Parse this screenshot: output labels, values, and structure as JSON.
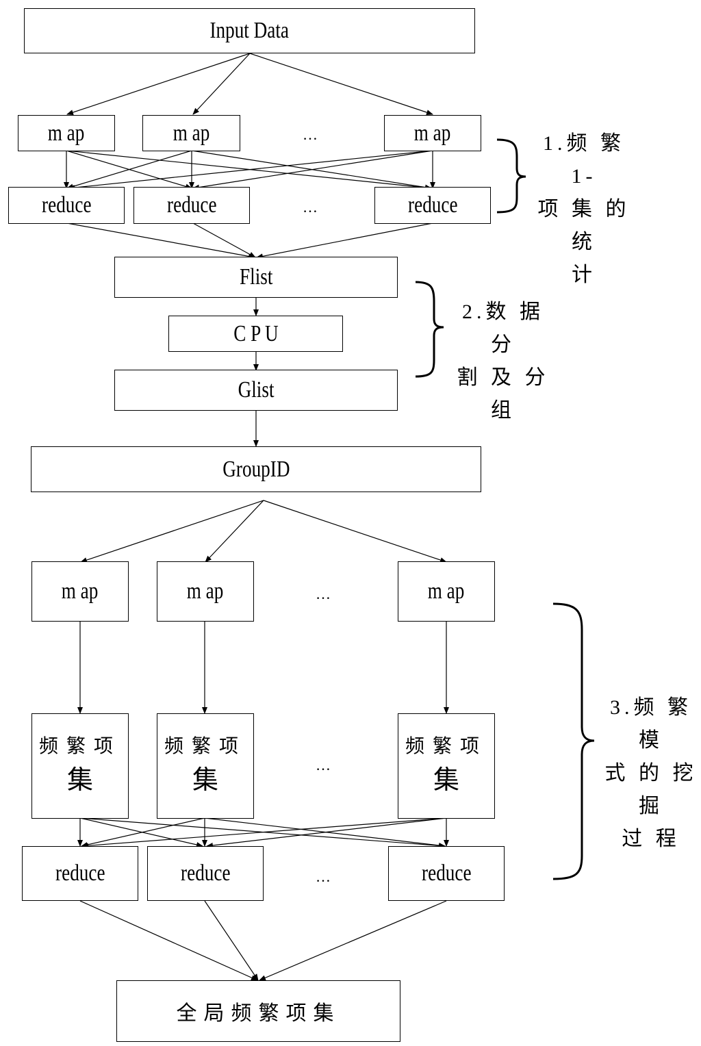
{
  "diagram": {
    "input": "Input Data",
    "stage1": {
      "map_label": "m ap",
      "reduce_label": "reduce",
      "ellipsis": "…",
      "annotation": "1.频 繁 1-\n项 集 的 统\n计"
    },
    "flist": "Flist",
    "cpu": "C P U",
    "glist": "Glist",
    "stage2_annotation": "2.数 据 分\n割 及 分 组",
    "groupid": "GroupID",
    "stage3": {
      "map_label": "m ap",
      "itemset_line1": "频繁项",
      "itemset_line2": "集",
      "reduce_label": "reduce",
      "ellipsis": "…",
      "annotation": "3.频 繁 模\n式 的 挖 掘\n过 程"
    },
    "output": "全局频繁项集"
  }
}
